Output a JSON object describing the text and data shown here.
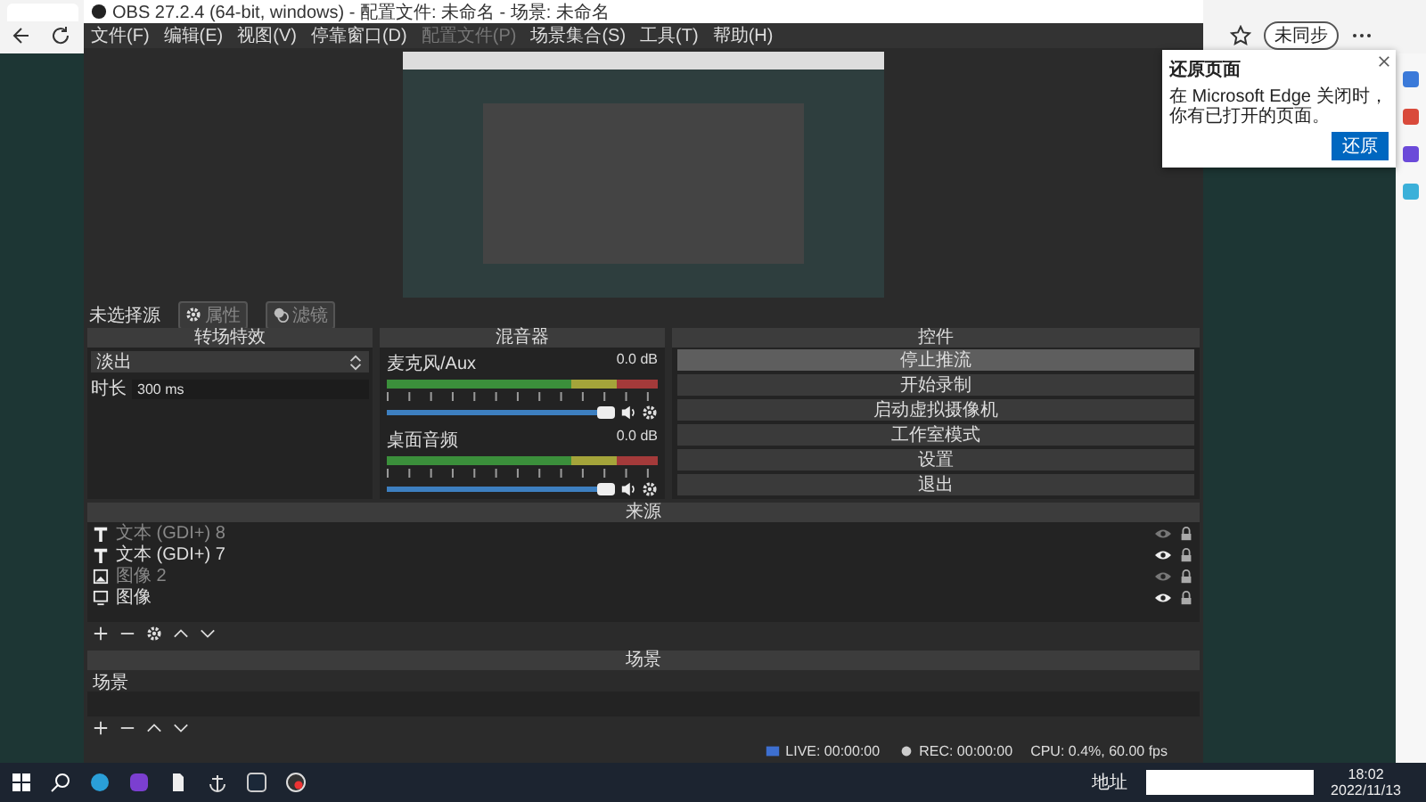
{
  "browser": {
    "sync_button": "未同步"
  },
  "obs": {
    "title": "OBS 27.2.4 (64-bit, windows) - 配置文件: 未命名 - 场景: 未命名",
    "menu": [
      {
        "label": "文件(F)",
        "disabled": false
      },
      {
        "label": "编辑(E)",
        "disabled": false
      },
      {
        "label": "视图(V)",
        "disabled": false
      },
      {
        "label": "停靠窗口(D)",
        "disabled": false
      },
      {
        "label": "配置文件(P)",
        "disabled": true
      },
      {
        "label": "场景集合(S)",
        "disabled": false
      },
      {
        "label": "工具(T)",
        "disabled": false
      },
      {
        "label": "帮助(H)",
        "disabled": false
      }
    ],
    "source_bar": {
      "label": "未选择源",
      "buttons": [
        {
          "kind": "properties",
          "label": "属性",
          "disabled": true
        },
        {
          "kind": "filters",
          "label": "滤镜",
          "disabled": true
        }
      ]
    },
    "transitions": {
      "title": "转场特效",
      "selected": "淡出",
      "duration_label": "时长",
      "duration": "300 ms"
    },
    "mixer": {
      "title": "混音器",
      "channels": [
        {
          "name": "麦克风/Aux",
          "reading": "0.0 dB",
          "level": 1
        },
        {
          "name": "桌面音频",
          "reading": "0.0 dB",
          "level": 1
        }
      ]
    },
    "controls": {
      "title": "控件",
      "buttons": [
        {
          "label": "停止推流",
          "hovered": true
        },
        {
          "label": "开始录制",
          "hovered": false
        },
        {
          "label": "启动虚拟摄像机",
          "hovered": false
        },
        {
          "label": "工作室模式",
          "hovered": false
        },
        {
          "label": "设置",
          "hovered": false
        },
        {
          "label": "退出",
          "hovered": false
        }
      ]
    },
    "sources": {
      "title": "来源",
      "items": [
        {
          "kind": "text",
          "name": "文本 (GDI+) 8",
          "visible": false
        },
        {
          "kind": "text",
          "name": "文本 (GDI+) 7",
          "visible": true
        },
        {
          "kind": "image",
          "name": "图像 2",
          "visible": false
        },
        {
          "kind": "display",
          "name": "图像",
          "visible": true
        }
      ]
    },
    "scenes": {
      "title": "场景",
      "items": [
        {
          "name": "场景"
        }
      ]
    },
    "status": {
      "live": "LIVE: 00:00:00",
      "rec": "REC: 00:00:00",
      "cpu": "CPU: 0.4%, 60.00 fps"
    }
  },
  "edge_popup": {
    "title": "还原页面",
    "message": "在 Microsoft Edge 关闭时，你有已打开的页面。",
    "button": "还原"
  },
  "taskbar": {
    "address_label": "地址",
    "time": "18:02",
    "date": "2022/11/13"
  }
}
